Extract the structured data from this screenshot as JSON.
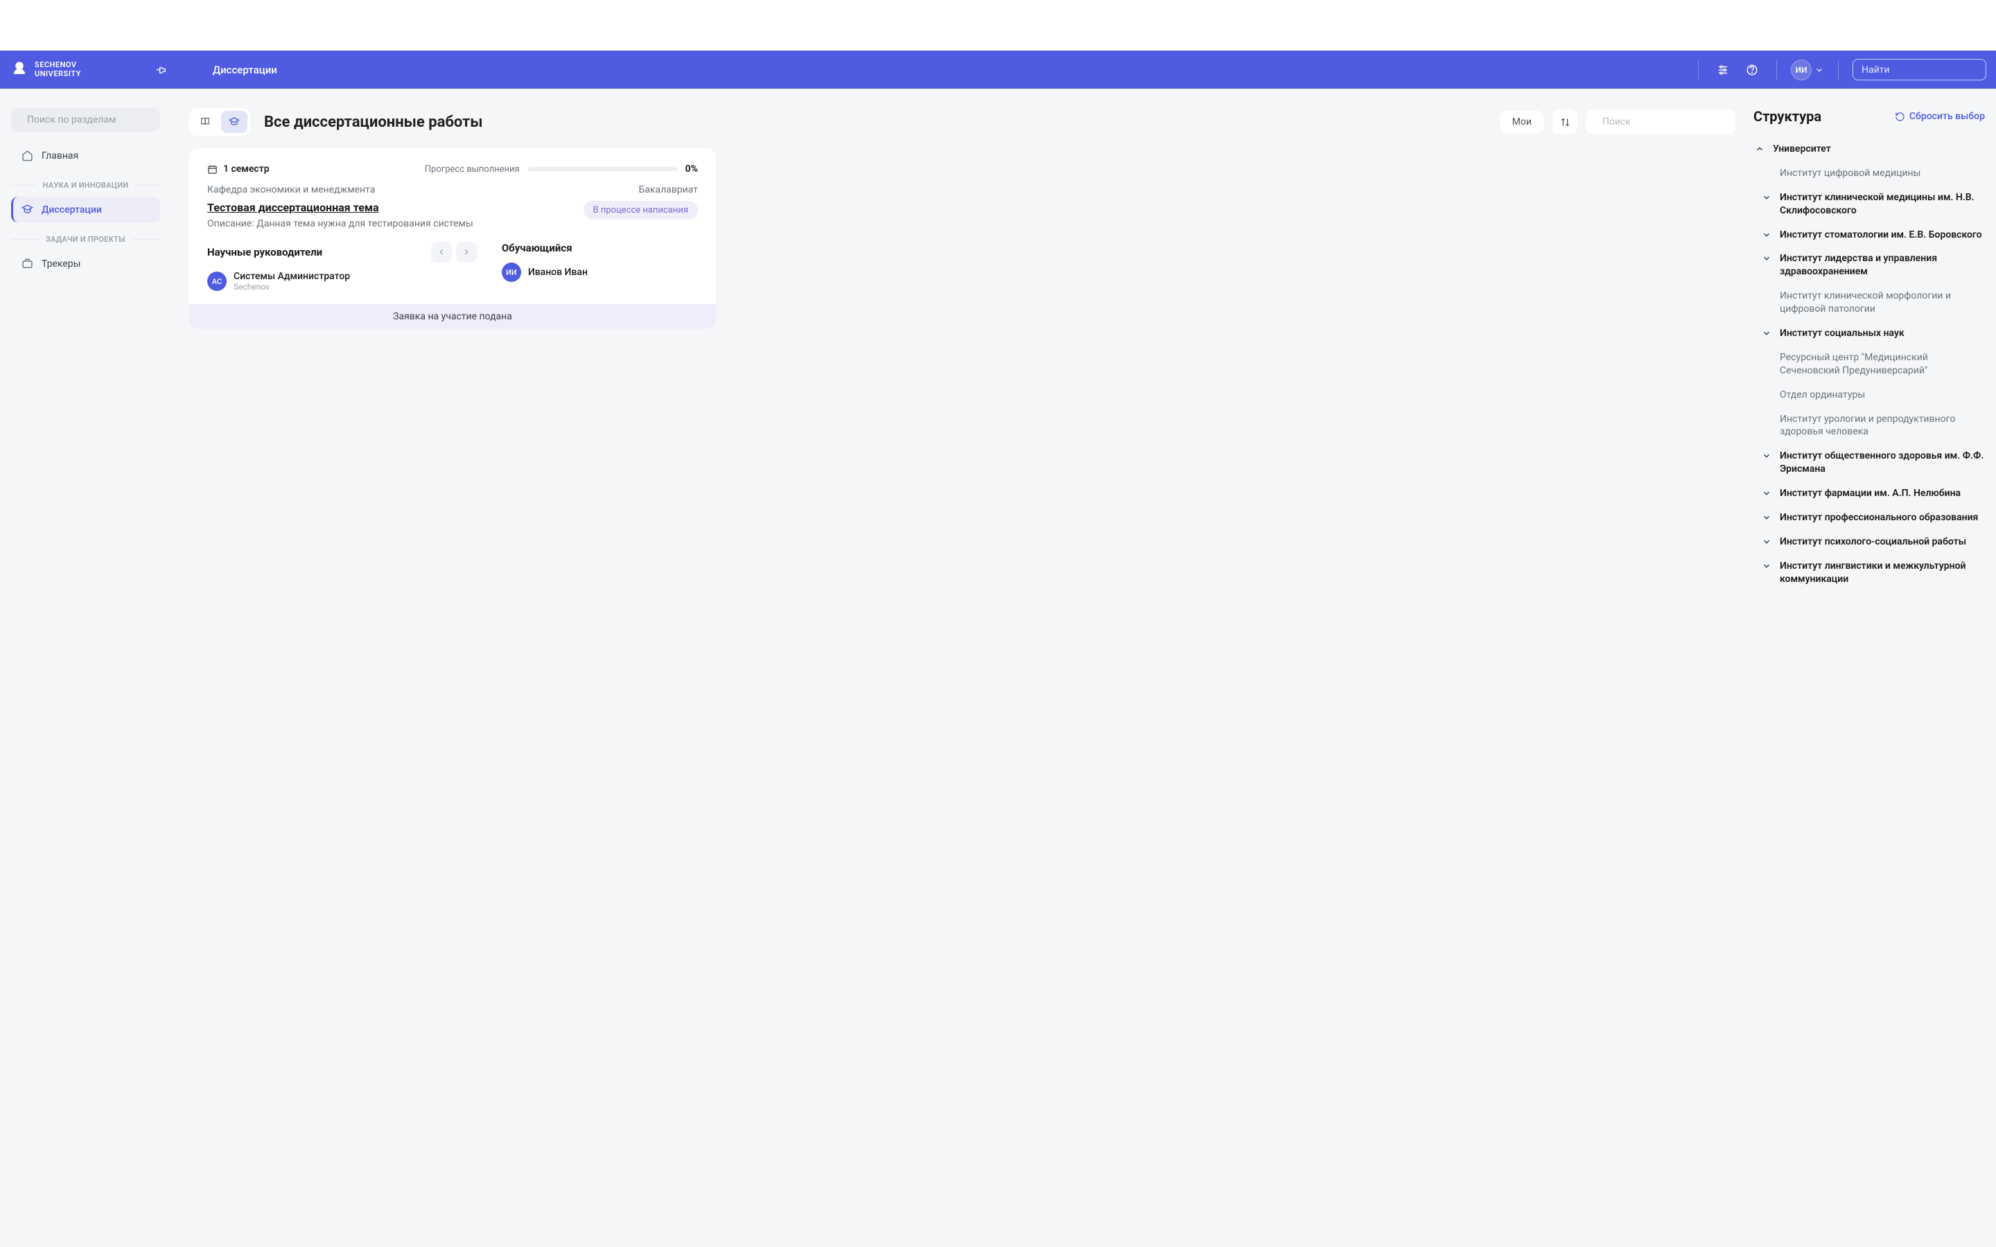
{
  "brand": {
    "line1": "SECHENOV",
    "line2": "UNIVERSITY"
  },
  "crumb": "Диссертации",
  "top_search_placeholder": "Найти",
  "avatar_initials": "ИИ",
  "sidebar": {
    "search_placeholder": "Поиск по разделам",
    "items": [
      {
        "label": "Главная"
      },
      {
        "label": "Диссертации"
      },
      {
        "label": "Трекеры"
      }
    ],
    "sections": {
      "science": "НАУКА И ИННОВАЦИИ",
      "tasks": "ЗАДАЧИ И ПРОЕКТЫ"
    }
  },
  "main": {
    "title": "Все диссертационные работы",
    "my_btn": "Мои",
    "search_placeholder": "Поиск"
  },
  "card": {
    "semester": "1 семестр",
    "progress_label": "Прогресс выполнения",
    "progress_value": "0%",
    "department": "Кафедра экономики и менеджмента",
    "level": "Бакалавриат",
    "title": "Тестовая диссертационная тема",
    "description": "Описание: Данная тема нужна для тестирования системы",
    "supervisors_title": "Научные руководители",
    "student_title": "Обучающийся",
    "supervisor": {
      "initials": "АС",
      "name": "Системы Администратор",
      "sub": "Sechenov"
    },
    "student": {
      "initials": "ИИ",
      "name": "Иванов Иван"
    },
    "status": "В процессе написания",
    "banner": "Заявка на участие подана"
  },
  "right": {
    "title": "Структура",
    "reset": "Сбросить выбор",
    "root": "Университет",
    "items": [
      {
        "label": "Институт цифровой медицины",
        "expandable": false
      },
      {
        "label": "Институт клинической медицины им. Н.В. Склифосовского",
        "expandable": true
      },
      {
        "label": "Институт стоматологии им. Е.В. Боровского",
        "expandable": true
      },
      {
        "label": "Институт лидерства и управления здравоохранением",
        "expandable": true
      },
      {
        "label": "Институт клинической морфологии и цифровой патологии",
        "expandable": false
      },
      {
        "label": "Институт социальных наук",
        "expandable": true
      },
      {
        "label": "Ресурсный центр \"Медицинский Сеченовский Предуниверсарий\"",
        "expandable": false
      },
      {
        "label": "Отдел ординатуры",
        "expandable": false
      },
      {
        "label": "Институт урологии и репродуктивного здоровья человека",
        "expandable": false
      },
      {
        "label": "Институт общественного здоровья им. Ф.Ф. Эрисмана",
        "expandable": true
      },
      {
        "label": "Институт фармации им. А.П. Нелюбина",
        "expandable": true
      },
      {
        "label": "Институт профессионального образования",
        "expandable": true
      },
      {
        "label": "Институт психолого-социальной работы",
        "expandable": true
      },
      {
        "label": "Институт лингвистики и межкультурной коммуникации",
        "expandable": true
      }
    ]
  }
}
